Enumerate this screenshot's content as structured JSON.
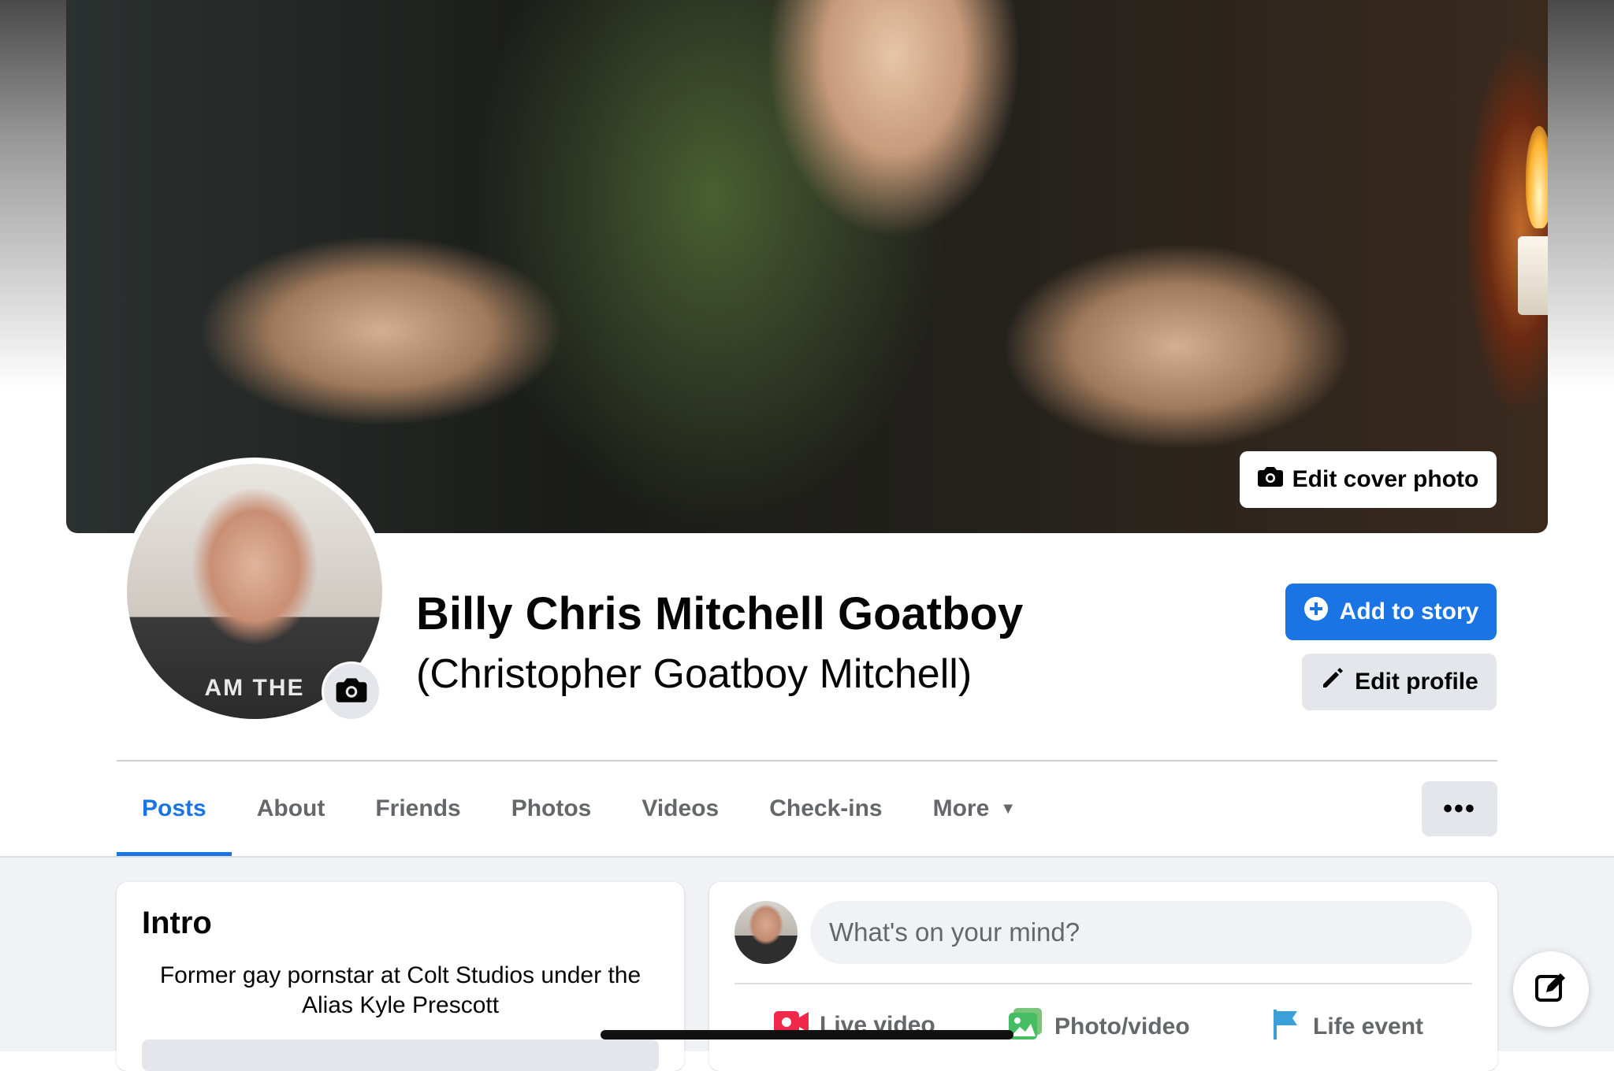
{
  "cover": {
    "edit_cover_label": "Edit cover photo"
  },
  "profile": {
    "name": "Billy Chris Mitchell Goatboy",
    "alternate_name": "(Christopher Goatboy Mitchell)",
    "avatar_shirt_text": "AM THE"
  },
  "actions": {
    "add_to_story_label": "Add to story",
    "edit_profile_label": "Edit profile",
    "more_options_label": "•••"
  },
  "tabs": [
    {
      "label": "Posts",
      "active": true
    },
    {
      "label": "About"
    },
    {
      "label": "Friends"
    },
    {
      "label": "Photos"
    },
    {
      "label": "Videos"
    },
    {
      "label": "Check-ins"
    },
    {
      "label": "More"
    }
  ],
  "intro": {
    "title": "Intro",
    "bio": "Former gay pornstar at Colt Studios under the Alias Kyle Prescott"
  },
  "composer": {
    "placeholder": "What's on your mind?",
    "live_video_label": "Live video",
    "photo_video_label": "Photo/video",
    "life_event_label": "Life event"
  },
  "colors": {
    "accent": "#1b74e4",
    "secondary_button": "#e4e6eb",
    "feed_background": "#f0f2f5",
    "muted_text": "#65676b"
  },
  "icons": {
    "camera": "camera-icon",
    "plus": "plus-circle-icon",
    "pencil": "pencil-icon",
    "caret": "caret-down-icon",
    "compose": "compose-icon",
    "live": "live-video-icon",
    "photo": "photo-icon",
    "flag": "flag-icon"
  }
}
